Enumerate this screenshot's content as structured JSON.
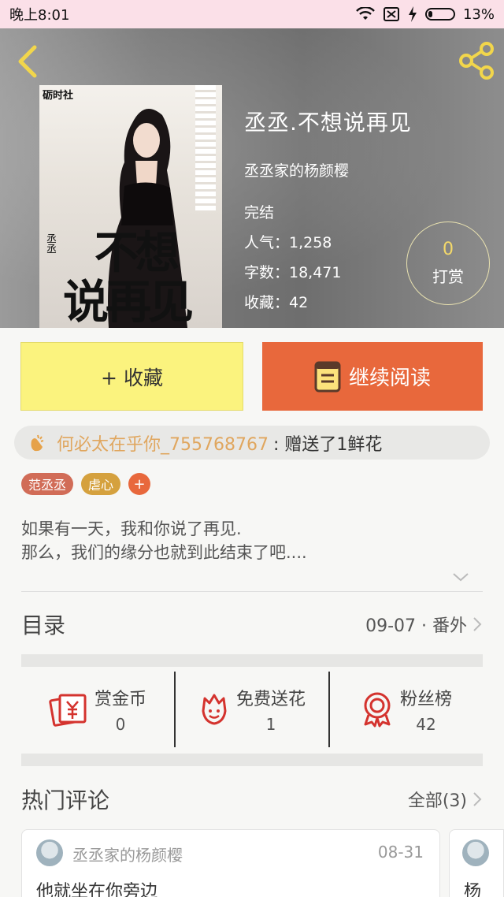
{
  "status_bar": {
    "time": "晚上8:01",
    "battery": "13%",
    "icons": [
      "wifi-icon",
      "sim-off-icon",
      "charging-icon",
      "battery-icon"
    ]
  },
  "book": {
    "cover_brand": "砺时社",
    "cover_title_line1": "不想",
    "cover_title_line2": "说再见",
    "cover_small": "丞丞",
    "title": "丞丞.不想说再见",
    "author": "丞丞家的杨颜樱",
    "status": "完结",
    "popularity": "人气：1,258",
    "word_count": "字数：18,471",
    "favorites": "收藏：42"
  },
  "reward": {
    "count": "0",
    "label": "打赏"
  },
  "actions": {
    "collect_label": "+ 收藏",
    "read_label": "继续阅读"
  },
  "gift": {
    "user": "何必太在乎你_755768767",
    "text": " : 赠送了1鲜花"
  },
  "tags": [
    {
      "label": "范丞丞",
      "color": "#d16c57"
    },
    {
      "label": "虐心",
      "color": "#d5a13e"
    }
  ],
  "tag_add_label": "+",
  "summary": {
    "line1": "如果有一天，我和你说了再见.",
    "line2": "那么，我们的缘分也就到此结束了吧...."
  },
  "toc": {
    "title": "目录",
    "latest": "09-07 · 番外"
  },
  "stats": [
    {
      "label": "赏金币",
      "value": "0",
      "icon": "red-envelope-icon"
    },
    {
      "label": "免费送花",
      "value": "1",
      "icon": "flower-icon"
    },
    {
      "label": "粉丝榜",
      "value": "42",
      "icon": "medal-icon"
    }
  ],
  "comments": {
    "title": "热门评论",
    "all_label": "全部(3)",
    "items": [
      {
        "user": "丞丞家的杨颜樱",
        "date": "08-31",
        "text": "他就坐在你旁边"
      },
      {
        "text": "杨"
      }
    ]
  },
  "colors": {
    "accent": "#e8683c",
    "collect_bg": "#fbf37e",
    "gift_user": "#e0a65e"
  }
}
